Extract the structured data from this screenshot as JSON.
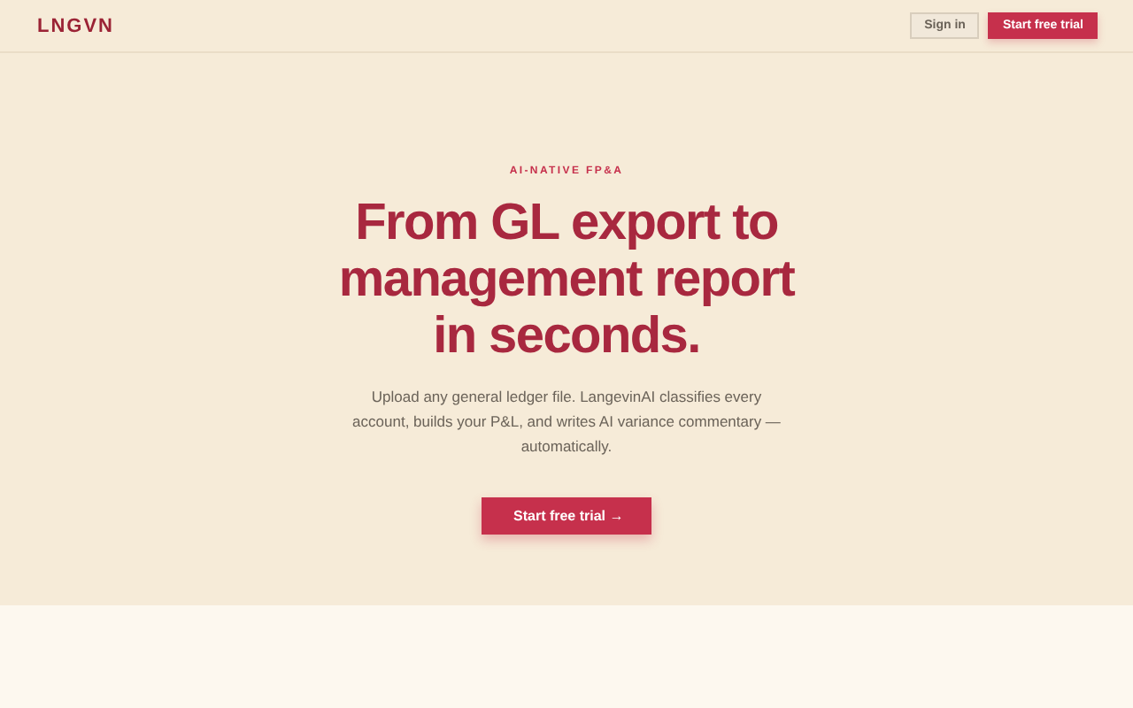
{
  "header": {
    "logo": "LNGVN",
    "sign_in": "Sign in",
    "cta": "Start free trial"
  },
  "hero": {
    "eyebrow": "AI-NATIVE FP&A",
    "headline": "From GL export to management report in seconds.",
    "description": "Upload any general ledger file. LangevinAI classifies every account, builds your P&L, and writes AI variance commentary — automatically.",
    "cta": "Start free trial →"
  }
}
